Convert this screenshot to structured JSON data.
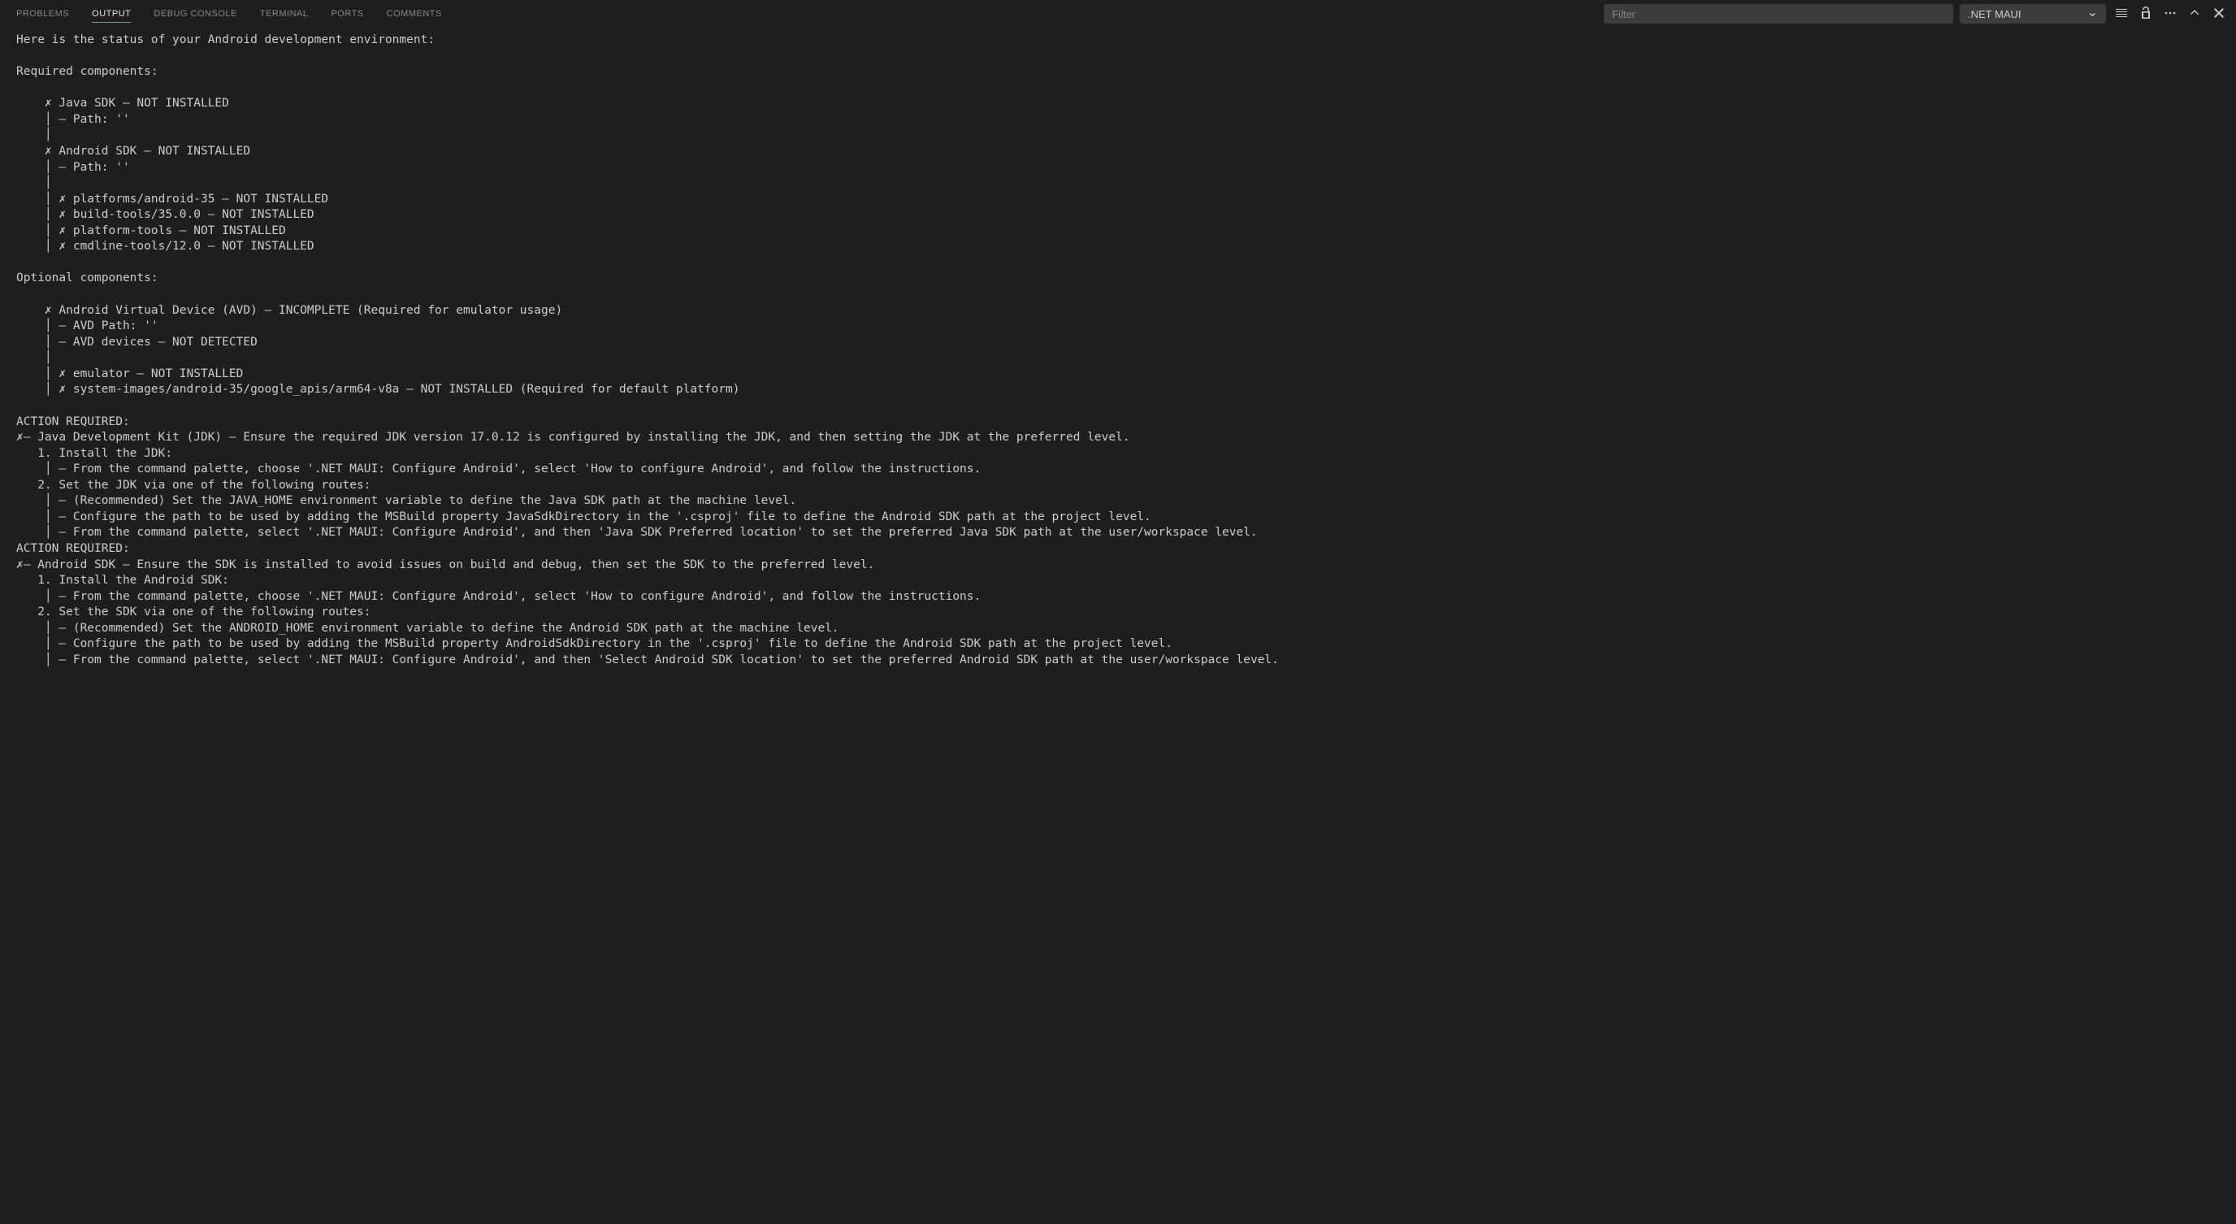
{
  "tabs": {
    "problems": "PROBLEMS",
    "output": "OUTPUT",
    "debug_console": "DEBUG CONSOLE",
    "terminal": "TERMINAL",
    "ports": "PORTS",
    "comments": "COMMENTS"
  },
  "filter": {
    "placeholder": "Filter"
  },
  "channel": {
    "selected": ".NET MAUI"
  },
  "output": {
    "text": "Here is the status of your Android development environment:\n\nRequired components:\n\n    ✗ Java SDK – NOT INSTALLED\n    │ – Path: ''\n    │\n    ✗ Android SDK – NOT INSTALLED\n    │ – Path: ''\n    │\n    │ ✗ platforms/android-35 – NOT INSTALLED\n    │ ✗ build-tools/35.0.0 – NOT INSTALLED\n    │ ✗ platform-tools – NOT INSTALLED\n    │ ✗ cmdline-tools/12.0 – NOT INSTALLED\n\nOptional components:\n\n    ✗ Android Virtual Device (AVD) – INCOMPLETE (Required for emulator usage)\n    │ – AVD Path: ''\n    │ – AVD devices – NOT DETECTED\n    │\n    │ ✗ emulator – NOT INSTALLED\n    │ ✗ system-images/android-35/google_apis/arm64-v8a – NOT INSTALLED (Required for default platform)\n\nACTION REQUIRED:\n✗– Java Development Kit (JDK) – Ensure the required JDK version 17.0.12 is configured by installing the JDK, and then setting the JDK at the preferred level.\n   1. Install the JDK:\n    │ – From the command palette, choose '.NET MAUI: Configure Android', select 'How to configure Android', and follow the instructions.\n   2. Set the JDK via one of the following routes:\n    │ – (Recommended) Set the JAVA_HOME environment variable to define the Java SDK path at the machine level.\n    │ – Configure the path to be used by adding the MSBuild property JavaSdkDirectory in the '.csproj' file to define the Android SDK path at the project level.\n    │ – From the command palette, select '.NET MAUI: Configure Android', and then 'Java SDK Preferred location' to set the preferred Java SDK path at the user/workspace level.\nACTION REQUIRED:\n✗– Android SDK – Ensure the SDK is installed to avoid issues on build and debug, then set the SDK to the preferred level.\n   1. Install the Android SDK:\n    │ – From the command palette, choose '.NET MAUI: Configure Android', select 'How to configure Android', and follow the instructions.\n   2. Set the SDK via one of the following routes:\n    │ – (Recommended) Set the ANDROID_HOME environment variable to define the Android SDK path at the machine level.\n    │ – Configure the path to be used by adding the MSBuild property AndroidSdkDirectory in the '.csproj' file to define the Android SDK path at the project level.\n    │ – From the command palette, select '.NET MAUI: Configure Android', and then 'Select Android SDK location' to set the preferred Android SDK path at the user/workspace level."
  }
}
